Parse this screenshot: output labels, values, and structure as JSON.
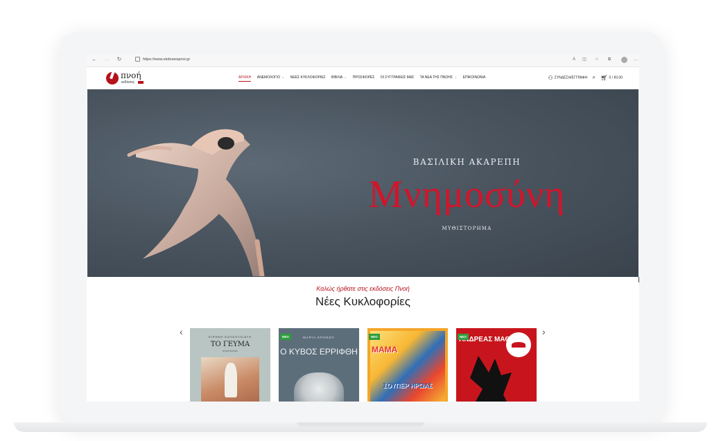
{
  "browser": {
    "url": "https://www.ekdoseispnoi.gr",
    "back_icon": "arrow-left-icon",
    "forward_icon": "arrow-right-icon",
    "reload_icon": "reload-icon"
  },
  "site": {
    "logo_name": "πνοή",
    "logo_sub": "εκδόσεις",
    "brand_color": "#b5121b"
  },
  "nav": {
    "items": [
      {
        "label": "ΑΡΧΙΚΗ"
      },
      {
        "label": "ΑΝΕΜΟΛΟΓΙΟ"
      },
      {
        "label": "ΝΕΕΣ ΚΥΚΛΟΦΟΡΙΕΣ"
      },
      {
        "label": "ΒΙΒΛΙΑ"
      },
      {
        "label": "ΠΡΟΣΦΟΡΕΣ"
      },
      {
        "label": "ΟΙ ΣΥΓΓΡΑΦΕΙΣ ΜΑΣ"
      },
      {
        "label": "ΤΑ ΝΕΑ ΤΗΣ ΠΝΟΗΣ"
      },
      {
        "label": "ΕΠΙΚΟΙΝΩΝΙΑ"
      }
    ],
    "login_label": "ΣΥΝΔΕΣΗ/ΕΓΓΡΑΦΗ",
    "cart_label": "0 / €0.00"
  },
  "hero": {
    "author": "ΒΑΣΙΛΙΚΗ ΑΚΑΡΕΠΗ",
    "title": "Μνημοσύνη",
    "genre": "ΜΥΘΙΣΤΟΡΗΜΑ"
  },
  "section": {
    "welcome": "Καλώς ήρθατε στις εκδόσεις Πνοή",
    "title": "Νέες Κυκλοφορίες"
  },
  "carousel": {
    "prev": "‹",
    "next": "›",
    "badge": "ΝΕΟ",
    "books": [
      {
        "author": "ΕΙΡΗΝΗ ΚΟΥΚΟΥΛΙΑΤΗ",
        "title": "ΤΟ ΓΕΥΜΑ",
        "subtitle": "ΜΥΘΙΣΤΟΡΗΜΑ"
      },
      {
        "author": "ΜΑΡΙΑ ΚΡΟΚΟΥ",
        "title": "Ο ΚΥΒΟΣ ΕΡΡΙΦΘΗ"
      },
      {
        "title": "ΜΑΜΑ",
        "title2": "ΣΟΥΠΕΡ ΗΡΩΑΣ"
      },
      {
        "title": "ΑΝΔΡΕΑΣ ΜΑΘΙΟΣ"
      }
    ]
  }
}
